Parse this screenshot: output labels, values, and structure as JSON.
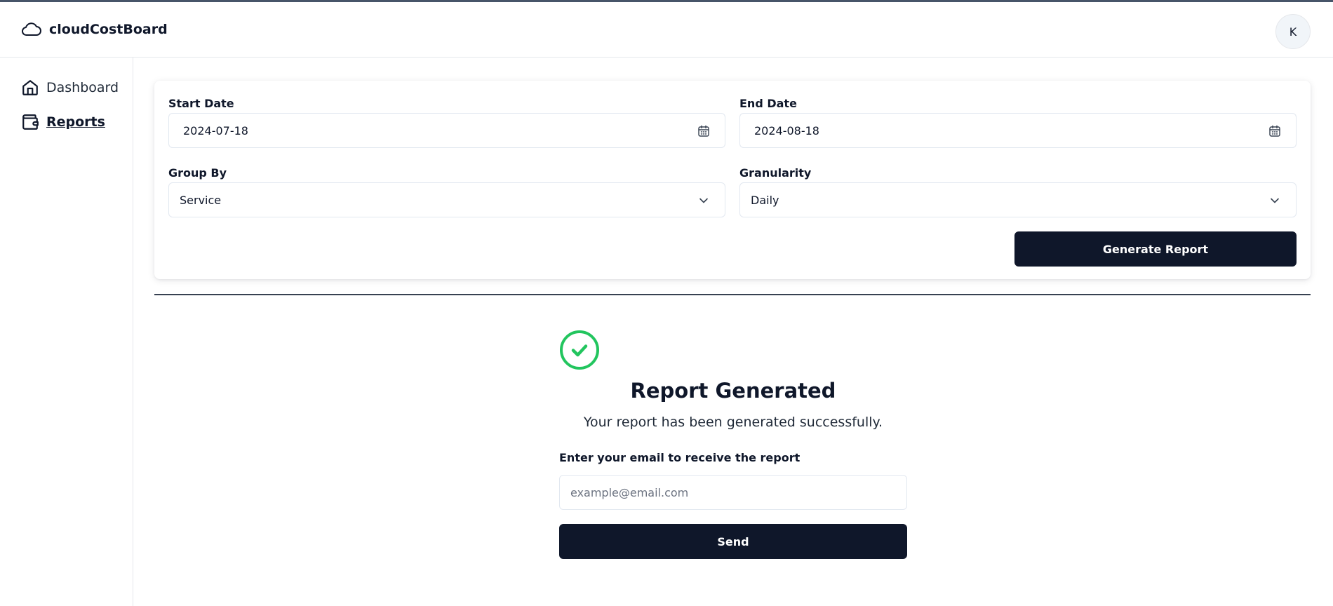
{
  "app": {
    "name": "cloudCostBoard",
    "logo_icon": "cloud-icon"
  },
  "user": {
    "initial": "K"
  },
  "sidebar": {
    "items": [
      {
        "label": "Dashboard",
        "icon": "home-icon",
        "active": false
      },
      {
        "label": "Reports",
        "icon": "wallet-icon",
        "active": true
      }
    ]
  },
  "form": {
    "start_date": {
      "label": "Start Date",
      "value": "2024-07-18"
    },
    "end_date": {
      "label": "End Date",
      "value": "2024-08-18"
    },
    "group_by": {
      "label": "Group By",
      "value": "Service"
    },
    "granularity": {
      "label": "Granularity",
      "value": "Daily"
    },
    "generate_label": "Generate Report"
  },
  "result": {
    "title": "Report Generated",
    "message": "Your report has been generated successfully.",
    "email_label": "Enter your email to receive the report",
    "email_placeholder": "example@email.com",
    "send_label": "Send"
  },
  "colors": {
    "primary": "#0f172a",
    "success": "#22c55e",
    "border": "#e2e8f0"
  }
}
